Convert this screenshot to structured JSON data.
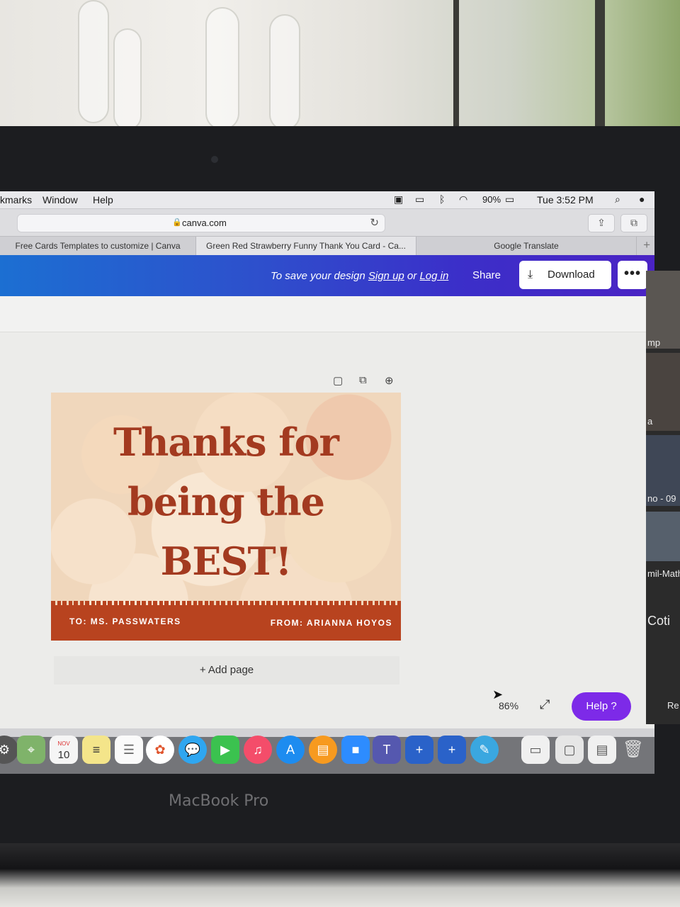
{
  "menubar": {
    "items": [
      "kmarks",
      "Window",
      "Help"
    ],
    "battery": "90%",
    "clock": "Tue 3:52 PM"
  },
  "browser": {
    "url": "canva.com",
    "tabs": [
      "Free Cards Templates to customize | Canva",
      "Green Red Strawberry Funny Thank You Card - Ca...",
      "Google Translate"
    ]
  },
  "header": {
    "save_prefix": "To save your design",
    "signup": "Sign up",
    "or": "or",
    "login": "Log in",
    "share": "Share",
    "download": "Download",
    "more": "•••"
  },
  "card": {
    "title_line1": "Thanks for",
    "title_line2": "being the",
    "title_line3": "BEST!",
    "to": "TO:  MS. PASSWATERS",
    "from": "FROM: ARIANNA HOYOS"
  },
  "editor": {
    "add_page": "+ Add page",
    "zoom": "86%",
    "help": "Help  ?"
  },
  "zoom_sidebar": {
    "labels": [
      "mp",
      "a",
      "no - 09",
      "mil-Math",
      "Coti",
      "Re"
    ]
  },
  "laptop_label": "MacBook Pro",
  "calendar_icon": {
    "month": "NOV",
    "day": "10"
  },
  "colors": {
    "brand_gradient_start": "#1c6fd2",
    "brand_gradient_end": "#4a23c4",
    "help_purple": "#7d2ae8",
    "card_title": "#a33a20",
    "card_footer": "#b8431f"
  }
}
